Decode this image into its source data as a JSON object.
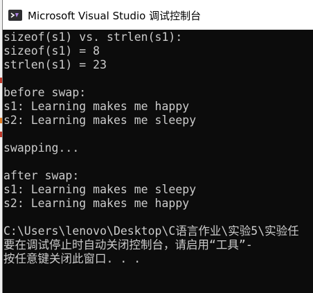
{
  "window": {
    "title": "Microsoft Visual Studio 调试控制台"
  },
  "console": {
    "lines": [
      "sizeof(s1) vs. strlen(s1):",
      "sizeof(s1) = 8",
      "strlen(s1) = 23",
      "",
      "before swap:",
      "s1: Learning makes me happy",
      "s2: Learning makes me sleepy",
      "",
      "swapping...",
      "",
      "after swap:",
      "s1: Learning makes me sleepy",
      "s2: Learning makes me happy",
      "",
      "C:\\Users\\lenovo\\Desktop\\C语言作业\\实验5\\实验任",
      "要在调试停止时自动关闭控制台，请启用“工具”-",
      "按任意键关闭此窗口. . ."
    ]
  },
  "colors": {
    "console_bg": "#0c0c0c",
    "console_text": "#cccccc",
    "titlebar_bg": "#ffffff"
  }
}
